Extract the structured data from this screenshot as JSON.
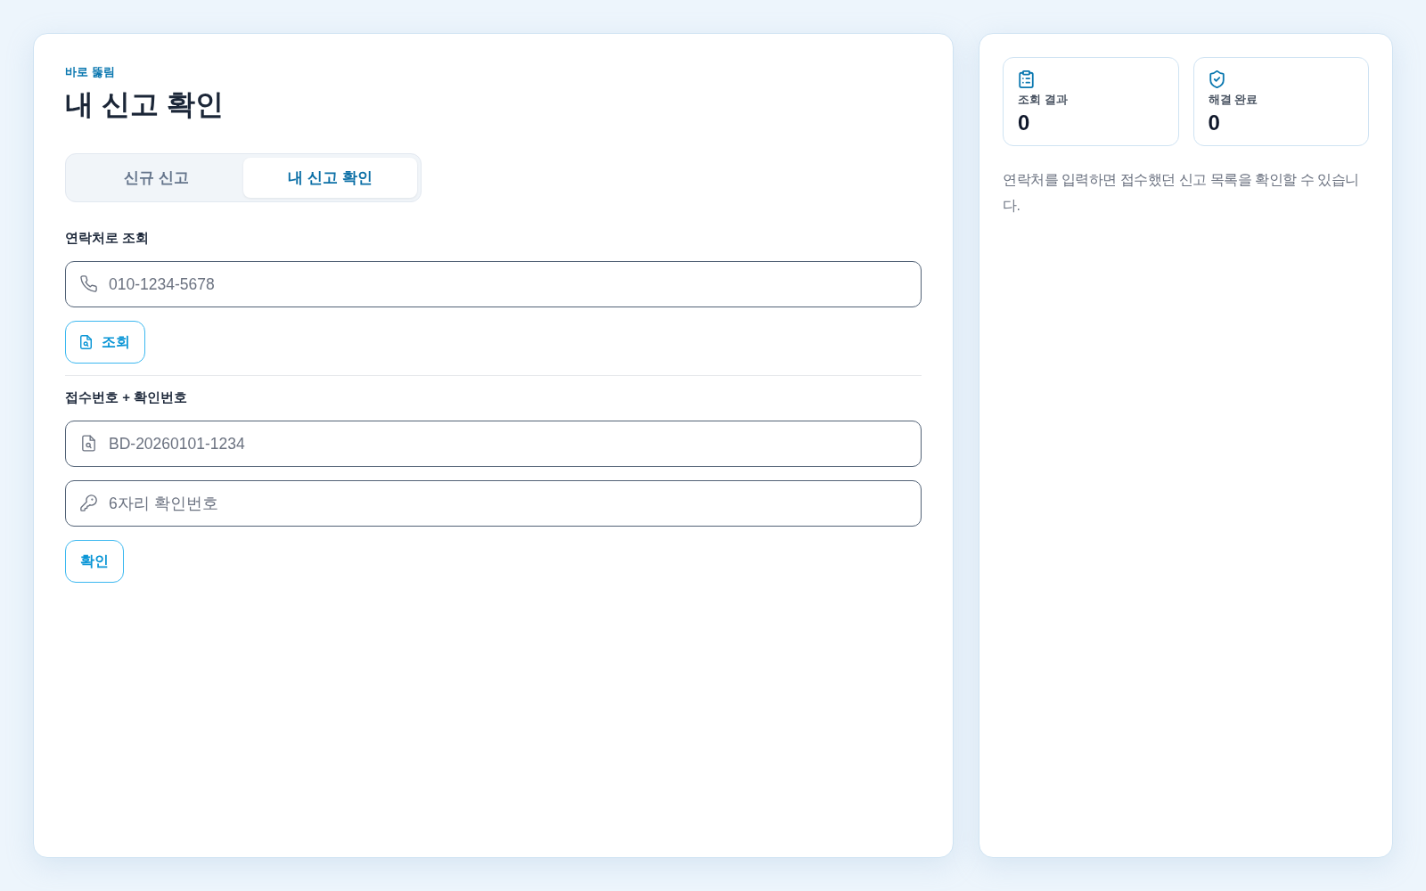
{
  "form_panel": {
    "eyebrow": "바로 뚫림",
    "title": "내 신고 확인",
    "tabs": [
      {
        "label": "신규 신고",
        "selected": false
      },
      {
        "label": "내 신고 확인",
        "selected": true
      }
    ],
    "sections": [
      {
        "heading": "연락처로 조회",
        "fields": [
          {
            "kind": "phone",
            "placeholder": "010-1234-5678"
          }
        ],
        "button": {
          "label": "조회",
          "has_icon": true
        }
      },
      {
        "heading": "접수번호 + 확인번호",
        "fields": [
          {
            "kind": "receipt",
            "placeholder": "BD-20260101-1234"
          },
          {
            "kind": "code",
            "placeholder": "6자리 확인번호"
          }
        ],
        "button": {
          "label": "확인",
          "has_icon": false
        }
      }
    ]
  },
  "summary_panel": {
    "stats": [
      {
        "kind": "results",
        "label": "조회 결과",
        "value": "0"
      },
      {
        "kind": "resolved",
        "label": "해결 완료",
        "value": "0"
      }
    ],
    "hint": "연락처를 입력하면 접수했던 신고 목록을 확인할 수 있습니다."
  }
}
